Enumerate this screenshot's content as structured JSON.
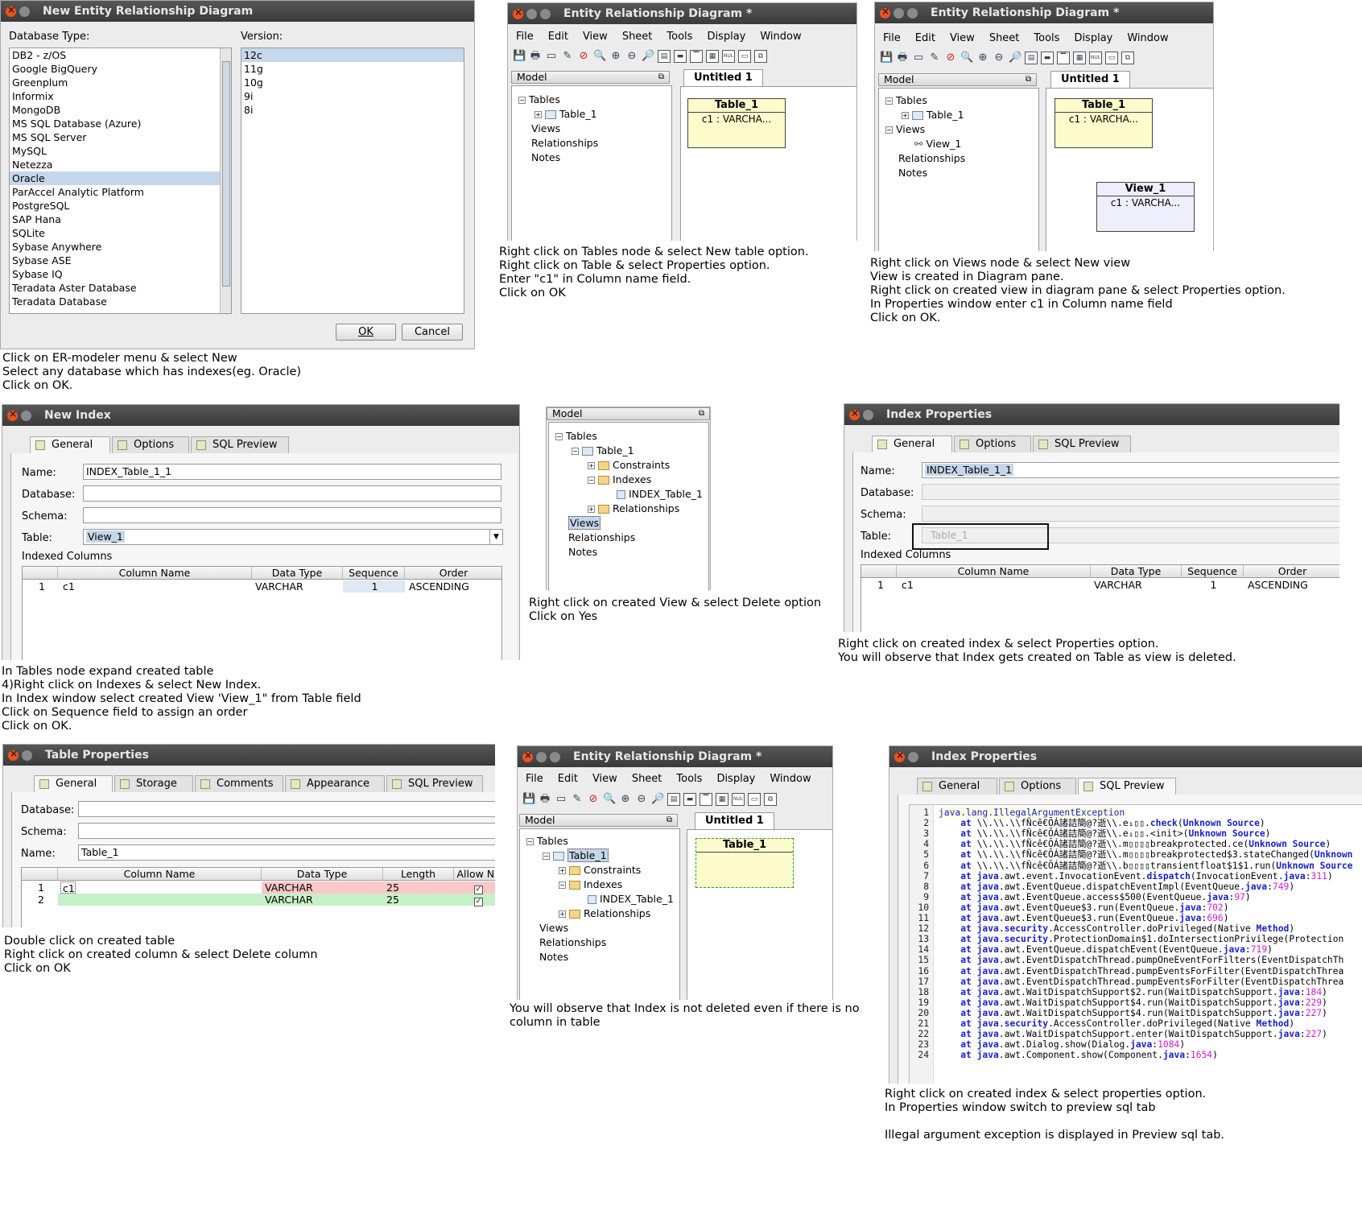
{
  "p1": {
    "title": "New Entity Relationship Diagram",
    "db_label": "Database Type:",
    "ver_label": "Version:",
    "databases": [
      "DB2 - z/OS",
      "Google BigQuery",
      "Greenplum",
      "Informix",
      "MongoDB",
      "MS SQL Database (Azure)",
      "MS SQL Server",
      "MySQL",
      "Netezza",
      "Oracle",
      "ParAccel Analytic Platform",
      "PostgreSQL",
      "SAP Hana",
      "SQLite",
      "Sybase Anywhere",
      "Sybase ASE",
      "Sybase IQ",
      "Teradata Aster Database",
      "Teradata Database"
    ],
    "selected_db": "Oracle",
    "versions": [
      "12c",
      "11g",
      "10g",
      "9i",
      "8i"
    ],
    "ok": "OK",
    "cancel": "Cancel",
    "instructions": "Click on ER-modeler menu & select New\nSelect any database which has indexes(eg. Oracle)\nClick on OK."
  },
  "menu": [
    "File",
    "Edit",
    "View",
    "Sheet",
    "Tools",
    "Display",
    "Window"
  ],
  "erd_title": "Entity Relationship Diagram *",
  "model_label": "Model",
  "untitled": "Untitled 1",
  "p2": {
    "tree": {
      "tables": "Tables",
      "table1": "Table_1",
      "views": "Views",
      "rel": "Relationships",
      "notes": "Notes"
    },
    "entity": {
      "name": "Table_1",
      "row": "c1 : VARCHA..."
    },
    "instructions": "Right click on Tables node & select New table option.\nRight click on Table & select Properties option.\nEnter \"c1\" in Column name field.\nClick on OK"
  },
  "p3": {
    "tree": {
      "tables": "Tables",
      "table1": "Table_1",
      "views": "Views",
      "view1": "View_1",
      "rel": "Relationships",
      "notes": "Notes"
    },
    "entity": {
      "name": "Table_1",
      "row": "c1 : VARCHA..."
    },
    "view": {
      "name": "View_1",
      "row": "c1 : VARCHA..."
    },
    "instructions": "Right click on Views node & select New view\nView is created in Diagram pane.\nRight click on created view in diagram pane & select Properties option.\nIn Properties window enter c1 in Column name field\nClick on OK."
  },
  "p4": {
    "title": "New Index",
    "tabs": [
      "General",
      "Options",
      "SQL Preview"
    ],
    "name_label": "Name:",
    "name": "INDEX_Table_1_1",
    "db_label": "Database:",
    "schema_label": "Schema:",
    "table_label": "Table:",
    "table": "View_1",
    "indexed": "Indexed Columns",
    "cols": [
      "Column Name",
      "Data Type",
      "Sequence",
      "Order"
    ],
    "row": {
      "n": "1",
      "col": "c1",
      "type": "VARCHAR",
      "seq": "1",
      "order": "ASCENDING"
    },
    "instructions": "In Tables node expand created table\n4)Right click on Indexes & select New Index.\nIn Index window select created View 'View_1\" from Table field\nClick on Sequence field to assign an order\nClick on OK."
  },
  "p5": {
    "model": "Model",
    "tables": "Tables",
    "table1": "Table_1",
    "constraints": "Constraints",
    "indexes": "Indexes",
    "index1": "INDEX_Table_1",
    "rel": "Relationships",
    "views": "Views",
    "rel2": "Relationships",
    "notes": "Notes",
    "instructions": "Right click on created View & select Delete option\nClick on Yes"
  },
  "p6": {
    "title": "Index Properties",
    "tabs": [
      "General",
      "Options",
      "SQL Preview"
    ],
    "name_label": "Name:",
    "name": "INDEX_Table_1_1",
    "db_label": "Database:",
    "schema_label": "Schema:",
    "table_label": "Table:",
    "table": "Table_1",
    "indexed": "Indexed Columns",
    "cols": [
      "Column Name",
      "Data Type",
      "Sequence",
      "Order"
    ],
    "row": {
      "n": "1",
      "col": "c1",
      "type": "VARCHAR",
      "seq": "1",
      "order": "ASCENDING"
    },
    "instructions": "Right click on created index & select Properties option.\nYou will observe that Index gets created on Table as view is deleted."
  },
  "p7": {
    "title": "Table Properties",
    "tabs": [
      "General",
      "Storage",
      "Comments",
      "Appearance",
      "SQL Preview"
    ],
    "db_label": "Database:",
    "schema_label": "Schema:",
    "name_label": "Name:",
    "name": "Table_1",
    "cols": [
      "Column Name",
      "Data Type",
      "Length",
      "Allow Nulls"
    ],
    "rows": [
      {
        "n": "1",
        "col": "c1",
        "type": "VARCHAR",
        "len": "25",
        "nulls": "✓"
      },
      {
        "n": "2",
        "col": "",
        "type": "VARCHAR",
        "len": "25",
        "nulls": "✓"
      }
    ],
    "instructions": "Double click on created table\nRight click on created column & select Delete column\nClick on OK"
  },
  "p8": {
    "tree": {
      "tables": "Tables",
      "table1": "Table_1",
      "constraints": "Constraints",
      "indexes": "Indexes",
      "index1": "INDEX_Table_1",
      "rel": "Relationships",
      "views": "Views",
      "rel2": "Relationships",
      "notes": "Notes"
    },
    "entity": {
      "name": "Table_1"
    },
    "instructions": "You will observe that Index is not deleted even if there is no\ncolumn in table"
  },
  "p9": {
    "title": "Index Properties",
    "tabs": [
      "General",
      "Options",
      "SQL Preview"
    ],
    "instructions": "Right click on created index & select properties option.\nIn Properties window switch to preview sql tab\n\nIllegal argument exception is displayed in Preview sql tab."
  }
}
